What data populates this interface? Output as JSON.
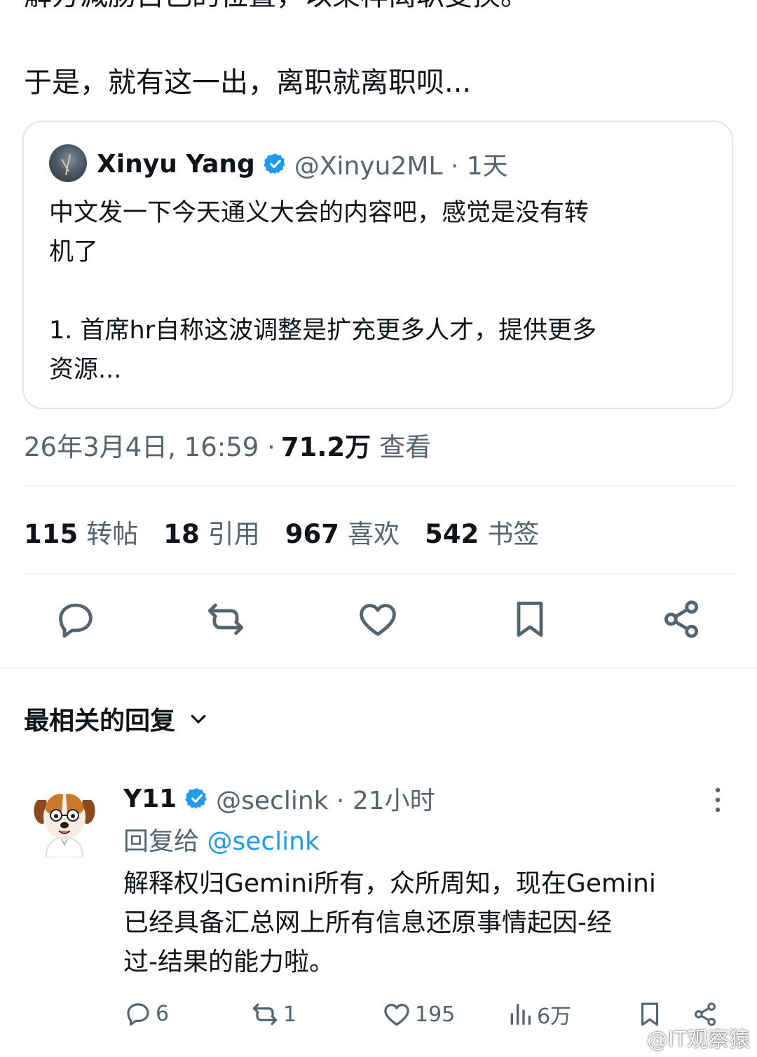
{
  "post": {
    "text_top_cut": "解方減肠自己的位置，以某样离职变换。",
    "text_lead": "于是，就有这一出，离职就离职呗..."
  },
  "quote": {
    "author_name": "Xinyu Yang",
    "author_handle": "@Xinyu2ML · 1天",
    "line1": "中文发一下今天通义大会的内容吧，感觉是没有转",
    "line2": "机了",
    "line3": "1. 首席hr自称这波调整是扩充更多人才，提供更多",
    "line4": "资源..."
  },
  "meta": {
    "datetime": "26年3月4日, 16:59 ·",
    "views_count": "71.2万",
    "views_label": "查看"
  },
  "stats": {
    "reposts_count": "115",
    "reposts_label": "转帖",
    "quotes_count": "18",
    "quotes_label": "引用",
    "likes_count": "967",
    "likes_label": "喜欢",
    "bookmarks_count": "542",
    "bookmarks_label": "书签"
  },
  "replies_header": {
    "sort_label": "最相关的回复"
  },
  "reply": {
    "author_name": "Y11",
    "author_handle": "@seclink · 21小时",
    "reply_to_prefix": "回复给",
    "reply_to_handle": "@seclink",
    "line1": "解释权归Gemini所有，众所周知，现在Gemini",
    "line2": "已经具备汇总网上所有信息还原事情起因-经",
    "line3": "过-结果的能力啦。",
    "replies": "6",
    "reposts": "1",
    "likes": "195",
    "views": "6万"
  },
  "watermark": "@IT观察猿",
  "colors": {
    "text_primary": "#0f1419",
    "text_secondary": "#536471",
    "accent": "#1d9bf0",
    "border": "#eff3f4"
  }
}
